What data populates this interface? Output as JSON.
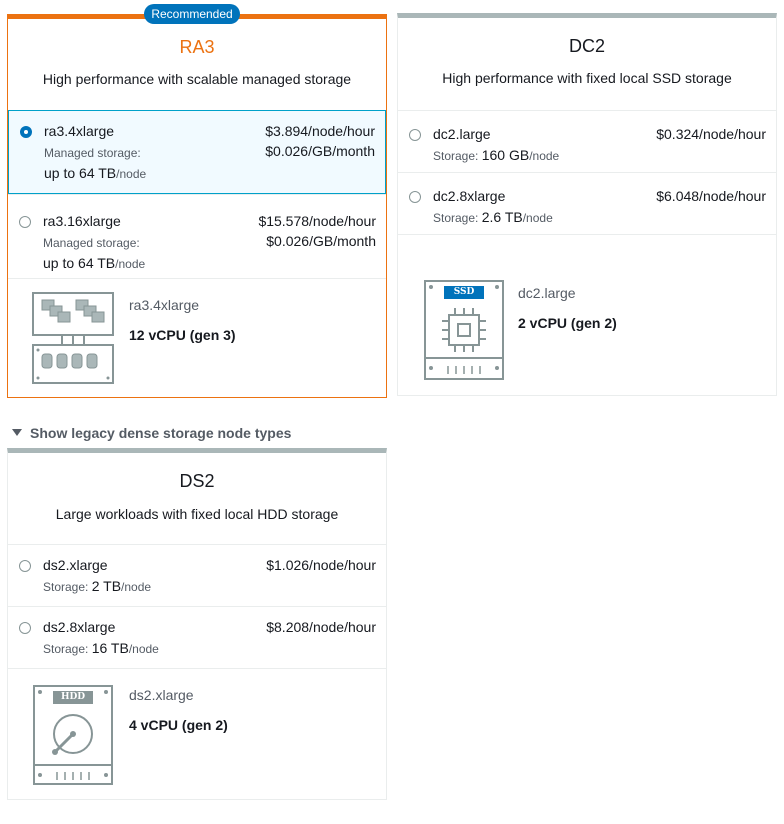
{
  "ra3": {
    "badge": "Recommended",
    "title": "RA3",
    "description": "High performance with scalable managed storage",
    "options": [
      {
        "name": "ra3.4xlarge",
        "price": "$3.894/node/hour",
        "storage_label": "Managed storage:",
        "storage_price": "$0.026/GB/month",
        "limit_value": "up to 64 TB",
        "limit_unit": "/node",
        "selected": true
      },
      {
        "name": "ra3.16xlarge",
        "price": "$15.578/node/hour",
        "storage_label": "Managed storage:",
        "storage_price": "$0.026/GB/month",
        "limit_value": "up to 64 TB",
        "limit_unit": "/node",
        "selected": false
      }
    ],
    "illustration": {
      "node": "ra3.4xlarge",
      "cpu": "12 vCPU (gen 3)"
    }
  },
  "dc2": {
    "title": "DC2",
    "description": "High performance with fixed local SSD storage",
    "options": [
      {
        "name": "dc2.large",
        "price": "$0.324/node/hour",
        "storage_label": "Storage:",
        "storage_value": "160 GB",
        "storage_unit": "/node",
        "selected": false
      },
      {
        "name": "dc2.8xlarge",
        "price": "$6.048/node/hour",
        "storage_label": "Storage:",
        "storage_value": "2.6 TB",
        "storage_unit": "/node",
        "selected": false
      }
    ],
    "illustration": {
      "chip_label": "SSD",
      "node": "dc2.large",
      "cpu": "2 vCPU (gen 2)"
    }
  },
  "legacy_toggle": "Show legacy dense storage node types",
  "ds2": {
    "title": "DS2",
    "description": "Large workloads with fixed local HDD storage",
    "options": [
      {
        "name": "ds2.xlarge",
        "price": "$1.026/node/hour",
        "storage_label": "Storage:",
        "storage_value": "2 TB",
        "storage_unit": "/node",
        "selected": false
      },
      {
        "name": "ds2.8xlarge",
        "price": "$8.208/node/hour",
        "storage_label": "Storage:",
        "storage_value": "16 TB",
        "storage_unit": "/node",
        "selected": false
      }
    ],
    "illustration": {
      "chip_label": "HDD",
      "node": "ds2.xlarge",
      "cpu": "4 vCPU (gen 2)"
    }
  },
  "colors": {
    "accent": "#ec7211",
    "selected_border": "#00a1c9",
    "radio_on": "#0073bb",
    "badge_bg": "#0073bb"
  }
}
